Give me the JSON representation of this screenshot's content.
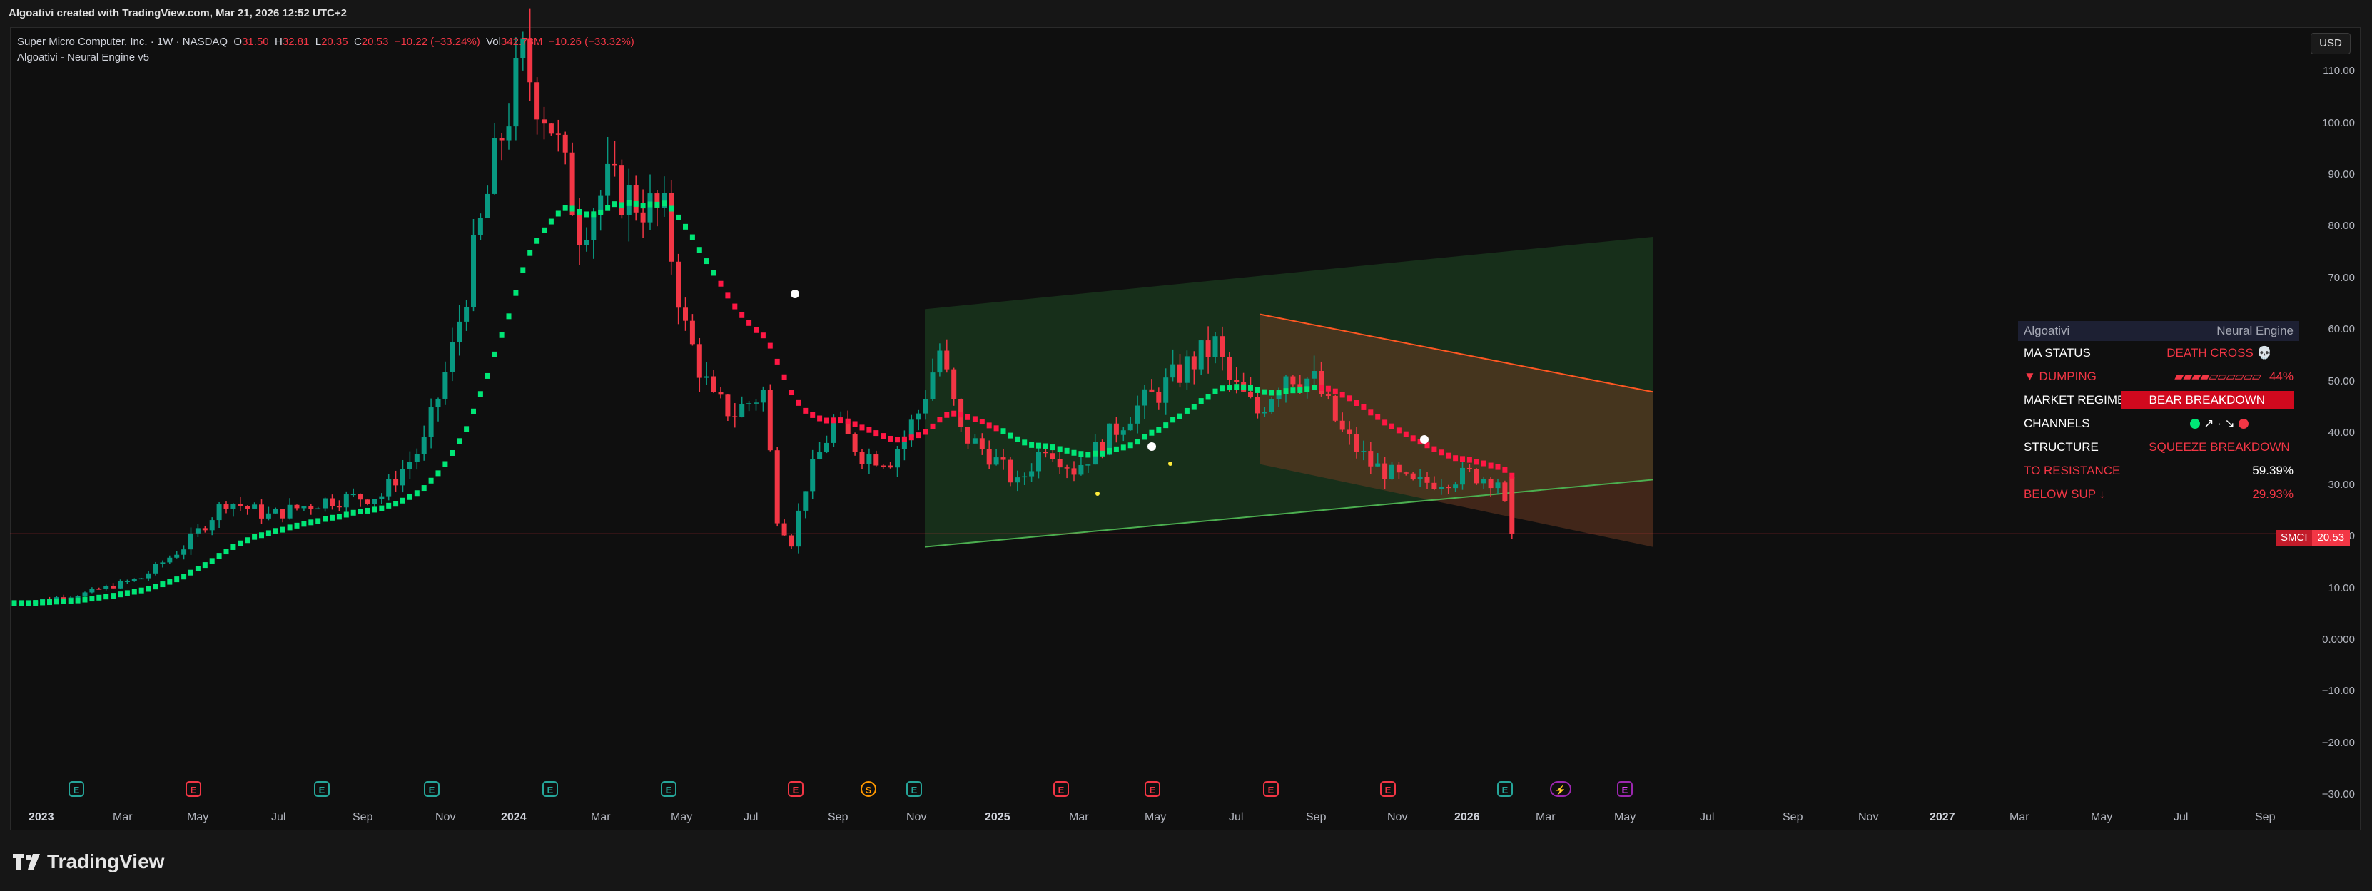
{
  "header": {
    "caption": "Algoativi created with TradingView.com, Mar 21, 2026 12:52 UTC+2"
  },
  "legend": {
    "symbol_line": "Super Micro Computer, Inc. · 1W · NASDAQ",
    "o_label": "O",
    "o": "31.50",
    "h_label": "H",
    "h": "32.81",
    "l_label": "L",
    "l": "20.35",
    "c_label": "C",
    "c": "20.53",
    "change": "−10.22 (−33.24%)",
    "vol_label": "Vol",
    "vol": "342.73M",
    "vol_change": "−10.26 (−33.32%)",
    "indicator": "Algoativi - Neural Engine v5"
  },
  "currency_button": "USD",
  "y_axis": {
    "ticks": [
      "110.00",
      "100.00",
      "90.00",
      "80.00",
      "70.00",
      "60.00",
      "50.00",
      "40.00",
      "30.00",
      "20.00",
      "10.00",
      "0.0000",
      "−10.00",
      "−20.00",
      "−30.00"
    ]
  },
  "x_axis": {
    "labels": [
      {
        "t": "2023",
        "bold": true
      },
      {
        "t": "Mar"
      },
      {
        "t": "May"
      },
      {
        "t": "Jul"
      },
      {
        "t": "Sep"
      },
      {
        "t": "Nov"
      },
      {
        "t": "2024",
        "bold": true
      },
      {
        "t": "Mar"
      },
      {
        "t": "May"
      },
      {
        "t": "Jul"
      },
      {
        "t": "Sep"
      },
      {
        "t": "Nov"
      },
      {
        "t": "2025",
        "bold": true
      },
      {
        "t": "Mar"
      },
      {
        "t": "May"
      },
      {
        "t": "Jul"
      },
      {
        "t": "Sep"
      },
      {
        "t": "Nov"
      },
      {
        "t": "2026",
        "bold": true
      },
      {
        "t": "Mar"
      },
      {
        "t": "May"
      },
      {
        "t": "Jul"
      },
      {
        "t": "Sep"
      },
      {
        "t": "Nov"
      },
      {
        "t": "2027",
        "bold": true
      },
      {
        "t": "Mar"
      },
      {
        "t": "May"
      },
      {
        "t": "Jul"
      },
      {
        "t": "Sep"
      }
    ]
  },
  "price_tag": {
    "symbol": "SMCI",
    "value": "20.53"
  },
  "events": [
    {
      "type": "e-green",
      "t": "E"
    },
    {
      "type": "e-red",
      "t": "E"
    },
    {
      "type": "e-green",
      "t": "E"
    },
    {
      "type": "e-green",
      "t": "E"
    },
    {
      "type": "e-green",
      "t": "E"
    },
    {
      "type": "e-green",
      "t": "E"
    },
    {
      "type": "e-red",
      "t": "E"
    },
    {
      "type": "s",
      "t": "S"
    },
    {
      "type": "e-green",
      "t": "E"
    },
    {
      "type": "e-red",
      "t": "E"
    },
    {
      "type": "e-red",
      "t": "E"
    },
    {
      "type": "e-red",
      "t": "E"
    },
    {
      "type": "e-red",
      "t": "E"
    },
    {
      "type": "e-green",
      "t": "E"
    },
    {
      "type": "sp",
      "t": "⚡"
    },
    {
      "type": "e-pur",
      "t": "E"
    }
  ],
  "panel": {
    "title_left": "Algoativi",
    "title_right": "Neural Engine",
    "ma_status_label": "MA STATUS",
    "ma_status_value": "DEATH CROSS 💀",
    "dumping_label": "▼ DUMPING",
    "dumping_bar": "▰▰▰▰▱▱▱▱▱▱",
    "dumping_pct": "44%",
    "regime_label": "MARKET REGIME",
    "regime_value": "BEAR BREAKDOWN",
    "channels_label": "CHANNELS",
    "channels_value": "↗ · ↘",
    "structure_label": "STRUCTURE",
    "structure_value": "SQUEEZE BREAKDOWN",
    "resistance_label": "TO RESISTANCE",
    "resistance_value": "59.39%",
    "support_label": "BELOW SUP ↓",
    "support_value": "29.93%"
  },
  "colors": {
    "up": "#089981",
    "down": "#f23645",
    "ma_up": "#00e676",
    "ma_down": "#ff1744",
    "channel_green": "#1b5e20",
    "channel_orange": "#5d4020",
    "bear_badge": "#d1091e"
  },
  "chart_data": {
    "type": "candlestick",
    "timeframe": "1W",
    "symbol": "SMCI",
    "ylim": [
      -30,
      115
    ],
    "grid": false,
    "last_close": 20.53,
    "key_points": [
      {
        "date": "2023-01",
        "close": 8
      },
      {
        "date": "2023-05",
        "close": 12
      },
      {
        "date": "2023-08",
        "close": 27
      },
      {
        "date": "2023-11",
        "close": 26
      },
      {
        "date": "2024-03",
        "close": 110
      },
      {
        "date": "2024-06",
        "close": 85
      },
      {
        "date": "2024-10",
        "close": 45
      },
      {
        "date": "2024-11",
        "close": 19
      },
      {
        "date": "2025-02",
        "close": 57
      },
      {
        "date": "2025-04",
        "close": 30
      },
      {
        "date": "2025-07",
        "close": 58
      },
      {
        "date": "2025-10",
        "close": 52
      },
      {
        "date": "2025-12",
        "close": 31
      },
      {
        "date": "2026-03",
        "close": 20.53
      }
    ]
  },
  "footer": {
    "brand": "TradingView"
  }
}
